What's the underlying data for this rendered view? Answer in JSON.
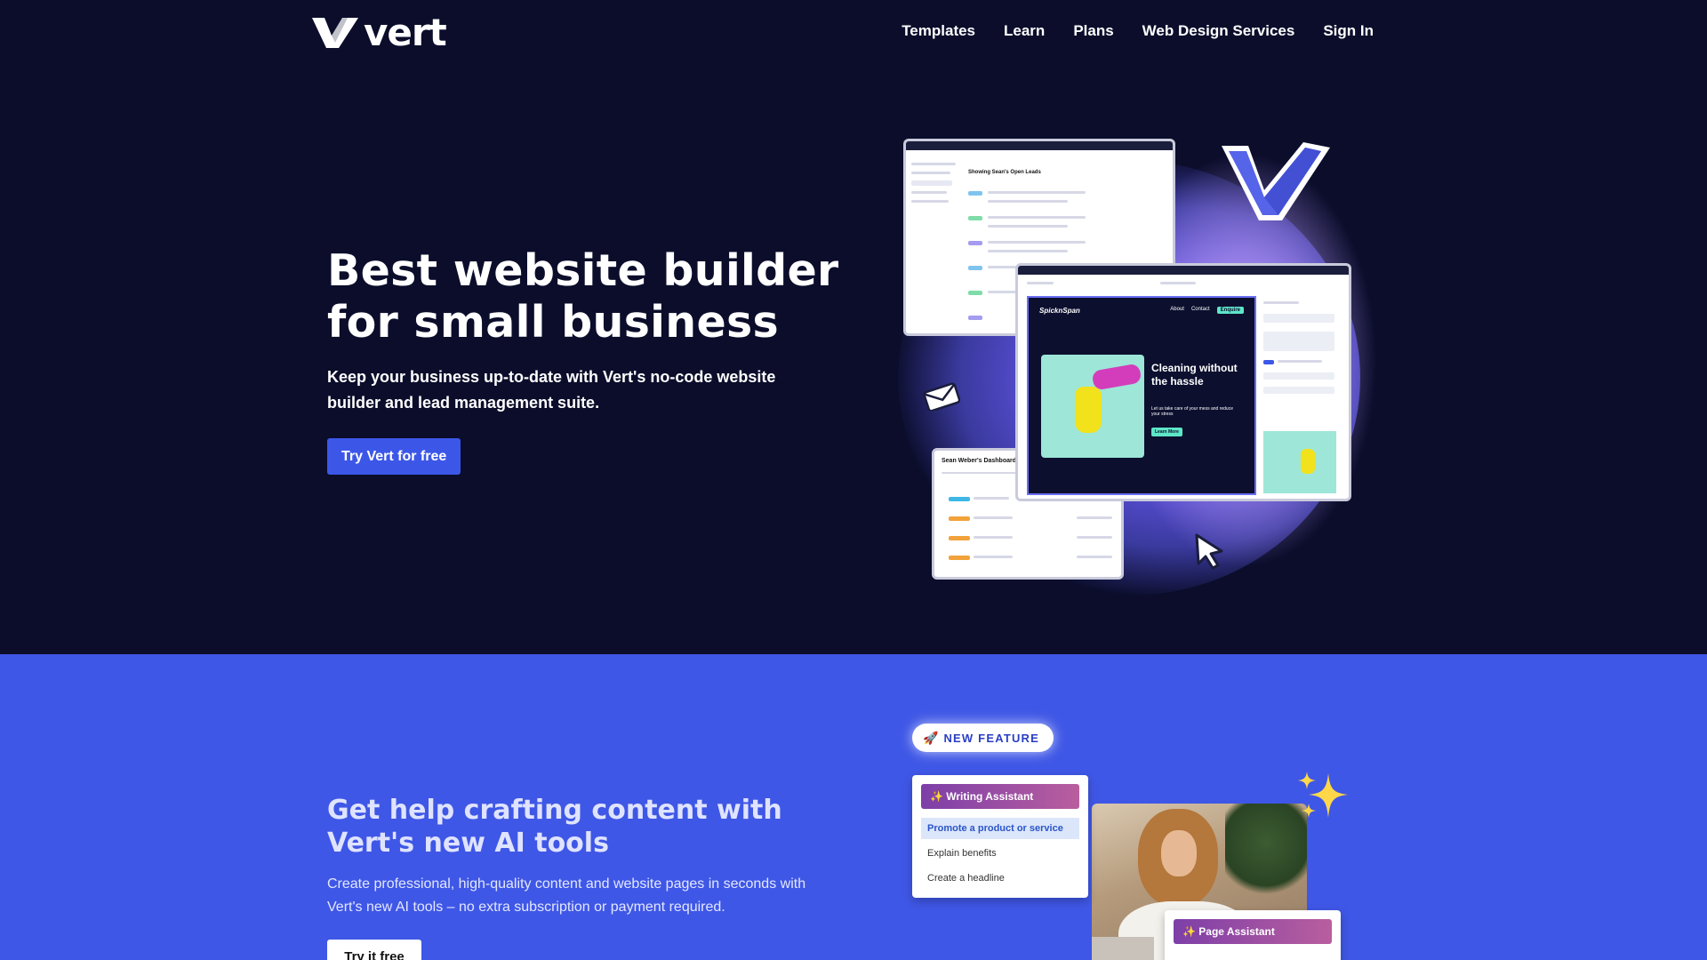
{
  "brand": {
    "name": "vert"
  },
  "nav": {
    "items": [
      {
        "label": "Templates"
      },
      {
        "label": "Learn"
      },
      {
        "label": "Plans"
      },
      {
        "label": "Web Design Services"
      },
      {
        "label": "Sign In"
      }
    ]
  },
  "hero": {
    "title": "Best website builder for small business",
    "subtitle": "Keep your business up-to-date with Vert's no-code website builder and lead management suite.",
    "cta_label": "Try Vert for free"
  },
  "hero_art": {
    "leads_title": "Showing Sean's Open Leads",
    "dashboard_title": "Sean Weber's Dashboard",
    "site_brand": "SpicknSpan",
    "site_nav": [
      "About",
      "Contact",
      "Enquire"
    ],
    "site_headline": "Cleaning without the hassle",
    "site_body": "Let us take care of your mess and reduce your stress",
    "site_button": "Learn More"
  },
  "ai_section": {
    "badge": "NEW FEATURE",
    "title": "Get help crafting content with Vert's new AI tools",
    "subtitle": "Create professional, high-quality content and website pages in seconds with Vert's new AI tools – no extra subscription or payment required.",
    "cta_label": "Try it free",
    "writing_assistant": {
      "label": "✨ Writing Assistant",
      "options": [
        "Promote a product or service",
        "Explain benefits",
        "Create a headline"
      ]
    },
    "page_assistant": {
      "label": "✨ Page Assistant"
    }
  },
  "colors": {
    "background": "#0b0d2b",
    "accent": "#3c57e8",
    "section_blue": "#3f57e6"
  },
  "icons": [
    "vert-logo-icon",
    "vert-check-icon",
    "envelope-icon",
    "cursor-icon",
    "rocket-icon",
    "sparkle-icon"
  ]
}
